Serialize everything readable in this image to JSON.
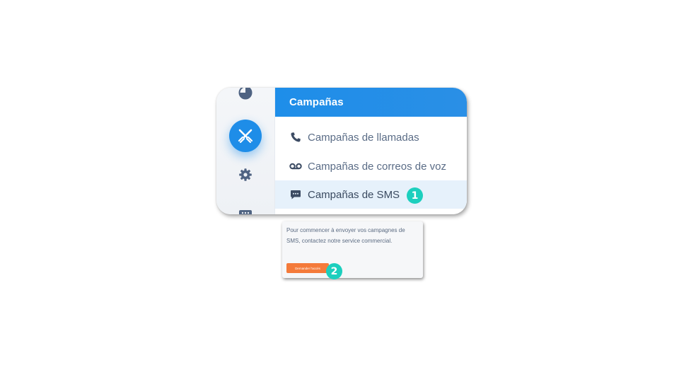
{
  "colors": {
    "accent_blue": "#1e8de8",
    "rail_icon": "#4f6382",
    "highlight_row": "#e6f1fb",
    "badge_teal": "#1ccfbe",
    "cta_orange": "#f47a3a"
  },
  "rail": {
    "items": [
      {
        "icon": "pie-chart-icon"
      },
      {
        "icon": "crossed-swords-icon",
        "active": true
      },
      {
        "icon": "gear-icon"
      },
      {
        "icon": "more-icon"
      }
    ]
  },
  "panel": {
    "title": "Campañas",
    "items": [
      {
        "label": "Campañas de llamadas",
        "icon": "phone-icon"
      },
      {
        "label": "Campañas de correos de voz",
        "icon": "voicemail-icon"
      },
      {
        "label": "Campañas de SMS",
        "icon": "chat-bubble-icon",
        "highlighted": true
      }
    ]
  },
  "badges": [
    "1",
    "2"
  ],
  "popup": {
    "text": "Pour commencer à envoyer vos campagnes de SMS, contactez notre service commercial.",
    "button_label": "Demander l'accès"
  }
}
